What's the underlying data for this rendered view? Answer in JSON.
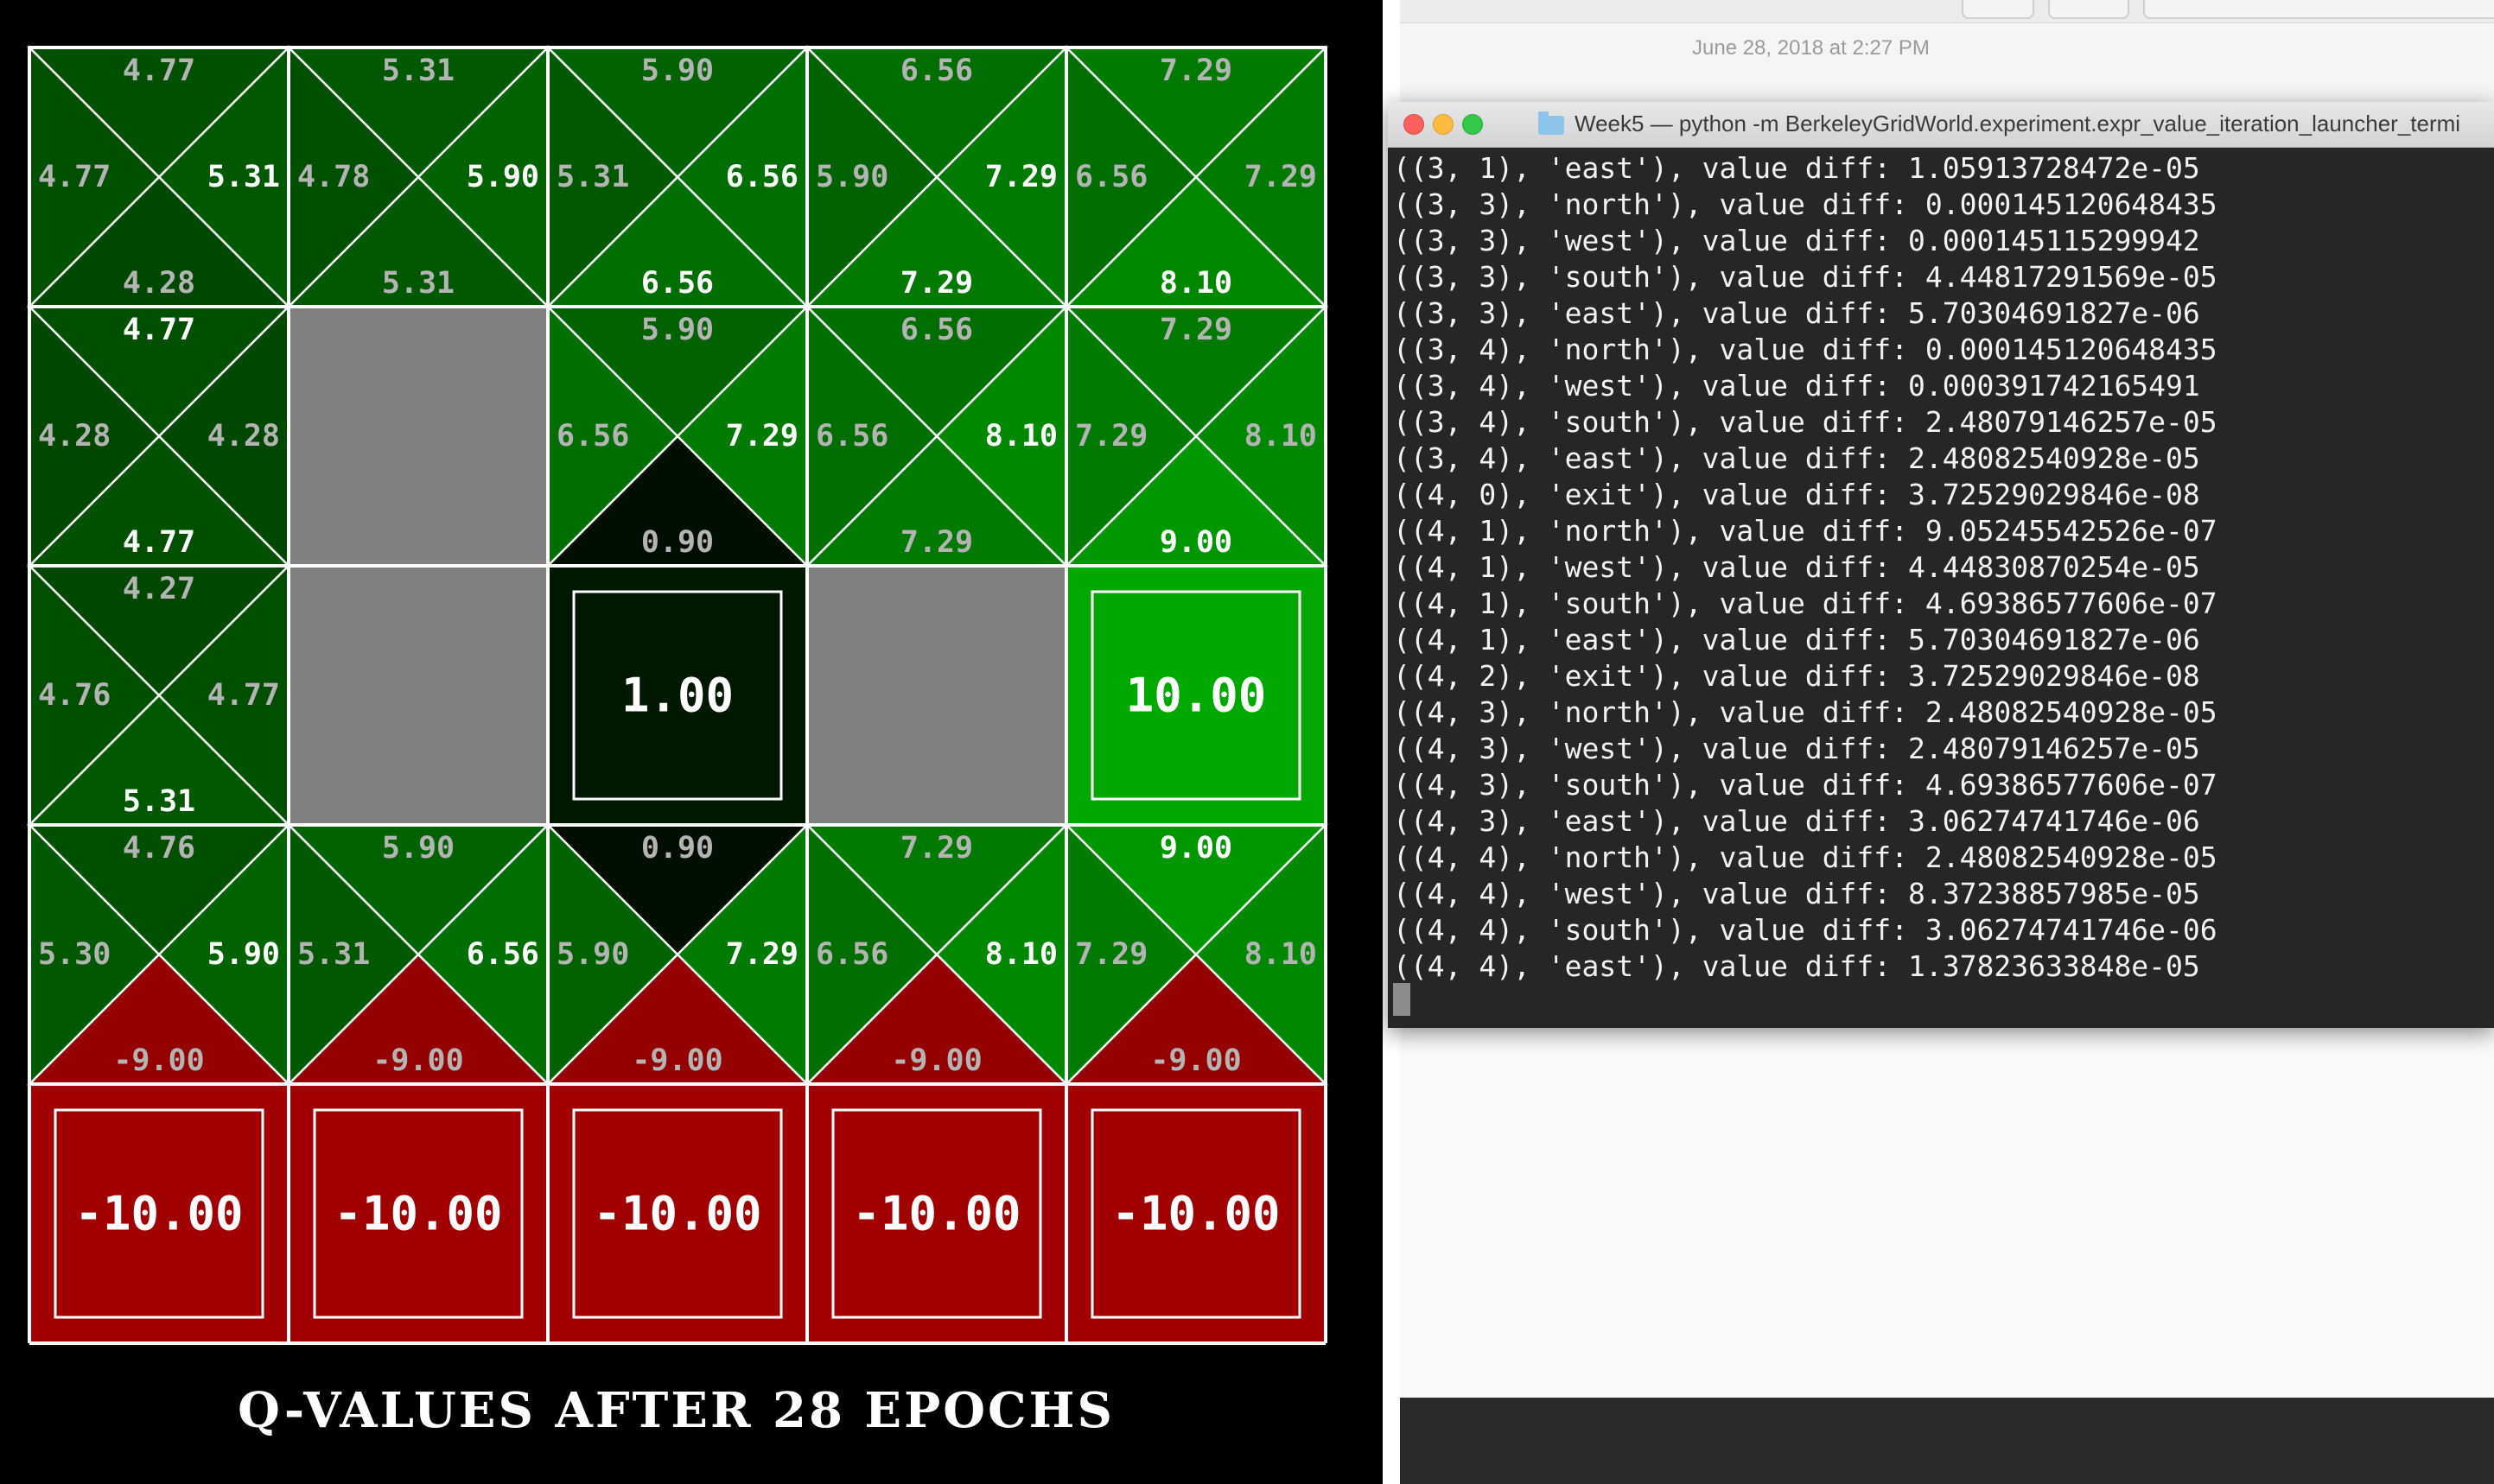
{
  "gridworld": {
    "caption": "Q-VALUES AFTER 28 EPOCHS",
    "colors": {
      "wall": "#808080",
      "negative_terminal": "#a00000",
      "positive_terminal": "#00a800",
      "line": "#ffffff"
    },
    "cells": [
      [
        {
          "type": "q",
          "q": {
            "north": "4.77",
            "west": "4.77",
            "east": "5.31",
            "south": "4.28"
          }
        },
        {
          "type": "q",
          "q": {
            "north": "5.31",
            "west": "4.78",
            "east": "5.90",
            "south": "5.31"
          }
        },
        {
          "type": "q",
          "q": {
            "north": "5.90",
            "west": "5.31",
            "east": "6.56",
            "south": "6.56"
          }
        },
        {
          "type": "q",
          "q": {
            "north": "6.56",
            "west": "5.90",
            "east": "7.29",
            "south": "7.29"
          }
        },
        {
          "type": "q",
          "q": {
            "north": "7.29",
            "west": "6.56",
            "east": "7.29",
            "south": "8.10"
          }
        }
      ],
      [
        {
          "type": "q",
          "q": {
            "north": "4.77",
            "west": "4.28",
            "east": "4.28",
            "south": "4.77"
          }
        },
        {
          "type": "wall"
        },
        {
          "type": "q",
          "q": {
            "north": "5.90",
            "west": "6.56",
            "east": "7.29",
            "south": "0.90"
          }
        },
        {
          "type": "q",
          "q": {
            "north": "6.56",
            "west": "6.56",
            "east": "8.10",
            "south": "7.29"
          }
        },
        {
          "type": "q",
          "q": {
            "north": "7.29",
            "west": "7.29",
            "east": "8.10",
            "south": "9.00"
          }
        }
      ],
      [
        {
          "type": "q",
          "q": {
            "north": "4.27",
            "west": "4.76",
            "east": "4.77",
            "south": "5.31"
          }
        },
        {
          "type": "wall"
        },
        {
          "type": "terminal",
          "value": "1.00"
        },
        {
          "type": "wall"
        },
        {
          "type": "terminal",
          "value": "10.00"
        }
      ],
      [
        {
          "type": "q",
          "q": {
            "north": "4.76",
            "west": "5.30",
            "east": "5.90",
            "south": "-9.00"
          }
        },
        {
          "type": "q",
          "q": {
            "north": "5.90",
            "west": "5.31",
            "east": "6.56",
            "south": "-9.00"
          }
        },
        {
          "type": "q",
          "q": {
            "north": "0.90",
            "west": "5.90",
            "east": "7.29",
            "south": "-9.00"
          }
        },
        {
          "type": "q",
          "q": {
            "north": "7.29",
            "west": "6.56",
            "east": "8.10",
            "south": "-9.00"
          }
        },
        {
          "type": "q",
          "q": {
            "north": "9.00",
            "west": "7.29",
            "east": "8.10",
            "south": "-9.00"
          }
        }
      ],
      [
        {
          "type": "terminal",
          "value": "-10.00"
        },
        {
          "type": "terminal",
          "value": "-10.00"
        },
        {
          "type": "terminal",
          "value": "-10.00"
        },
        {
          "type": "terminal",
          "value": "-10.00"
        },
        {
          "type": "terminal",
          "value": "-10.00"
        }
      ]
    ]
  },
  "background": {
    "date": "June 28, 2018 at 2:27 PM"
  },
  "terminal": {
    "title": "Week5 — python -m BerkeleyGridWorld.experiment.expr_value_iteration_launcher_termi",
    "lines": [
      "((3, 1), 'east'), value diff: 1.05913728472e-05",
      "((3, 3), 'north'), value diff: 0.000145120648435",
      "((3, 3), 'west'), value diff: 0.000145115299942",
      "((3, 3), 'south'), value diff: 4.44817291569e-05",
      "((3, 3), 'east'), value diff: 5.70304691827e-06",
      "((3, 4), 'north'), value diff: 0.000145120648435",
      "((3, 4), 'west'), value diff: 0.000391742165491",
      "((3, 4), 'south'), value diff: 2.48079146257e-05",
      "((3, 4), 'east'), value diff: 2.48082540928e-05",
      "((4, 0), 'exit'), value diff: 3.72529029846e-08",
      "((4, 1), 'north'), value diff: 9.05245542526e-07",
      "((4, 1), 'west'), value diff: 4.44830870254e-05",
      "((4, 1), 'south'), value diff: 4.69386577606e-07",
      "((4, 1), 'east'), value diff: 5.70304691827e-06",
      "((4, 2), 'exit'), value diff: 3.72529029846e-08",
      "((4, 3), 'north'), value diff: 2.48082540928e-05",
      "((4, 3), 'west'), value diff: 2.48079146257e-05",
      "((4, 3), 'south'), value diff: 4.69386577606e-07",
      "((4, 3), 'east'), value diff: 3.06274741746e-06",
      "((4, 4), 'north'), value diff: 2.48082540928e-05",
      "((4, 4), 'west'), value diff: 8.37238857985e-05",
      "((4, 4), 'south'), value diff: 3.06274741746e-06",
      "((4, 4), 'east'), value diff: 1.37823633848e-05"
    ]
  }
}
